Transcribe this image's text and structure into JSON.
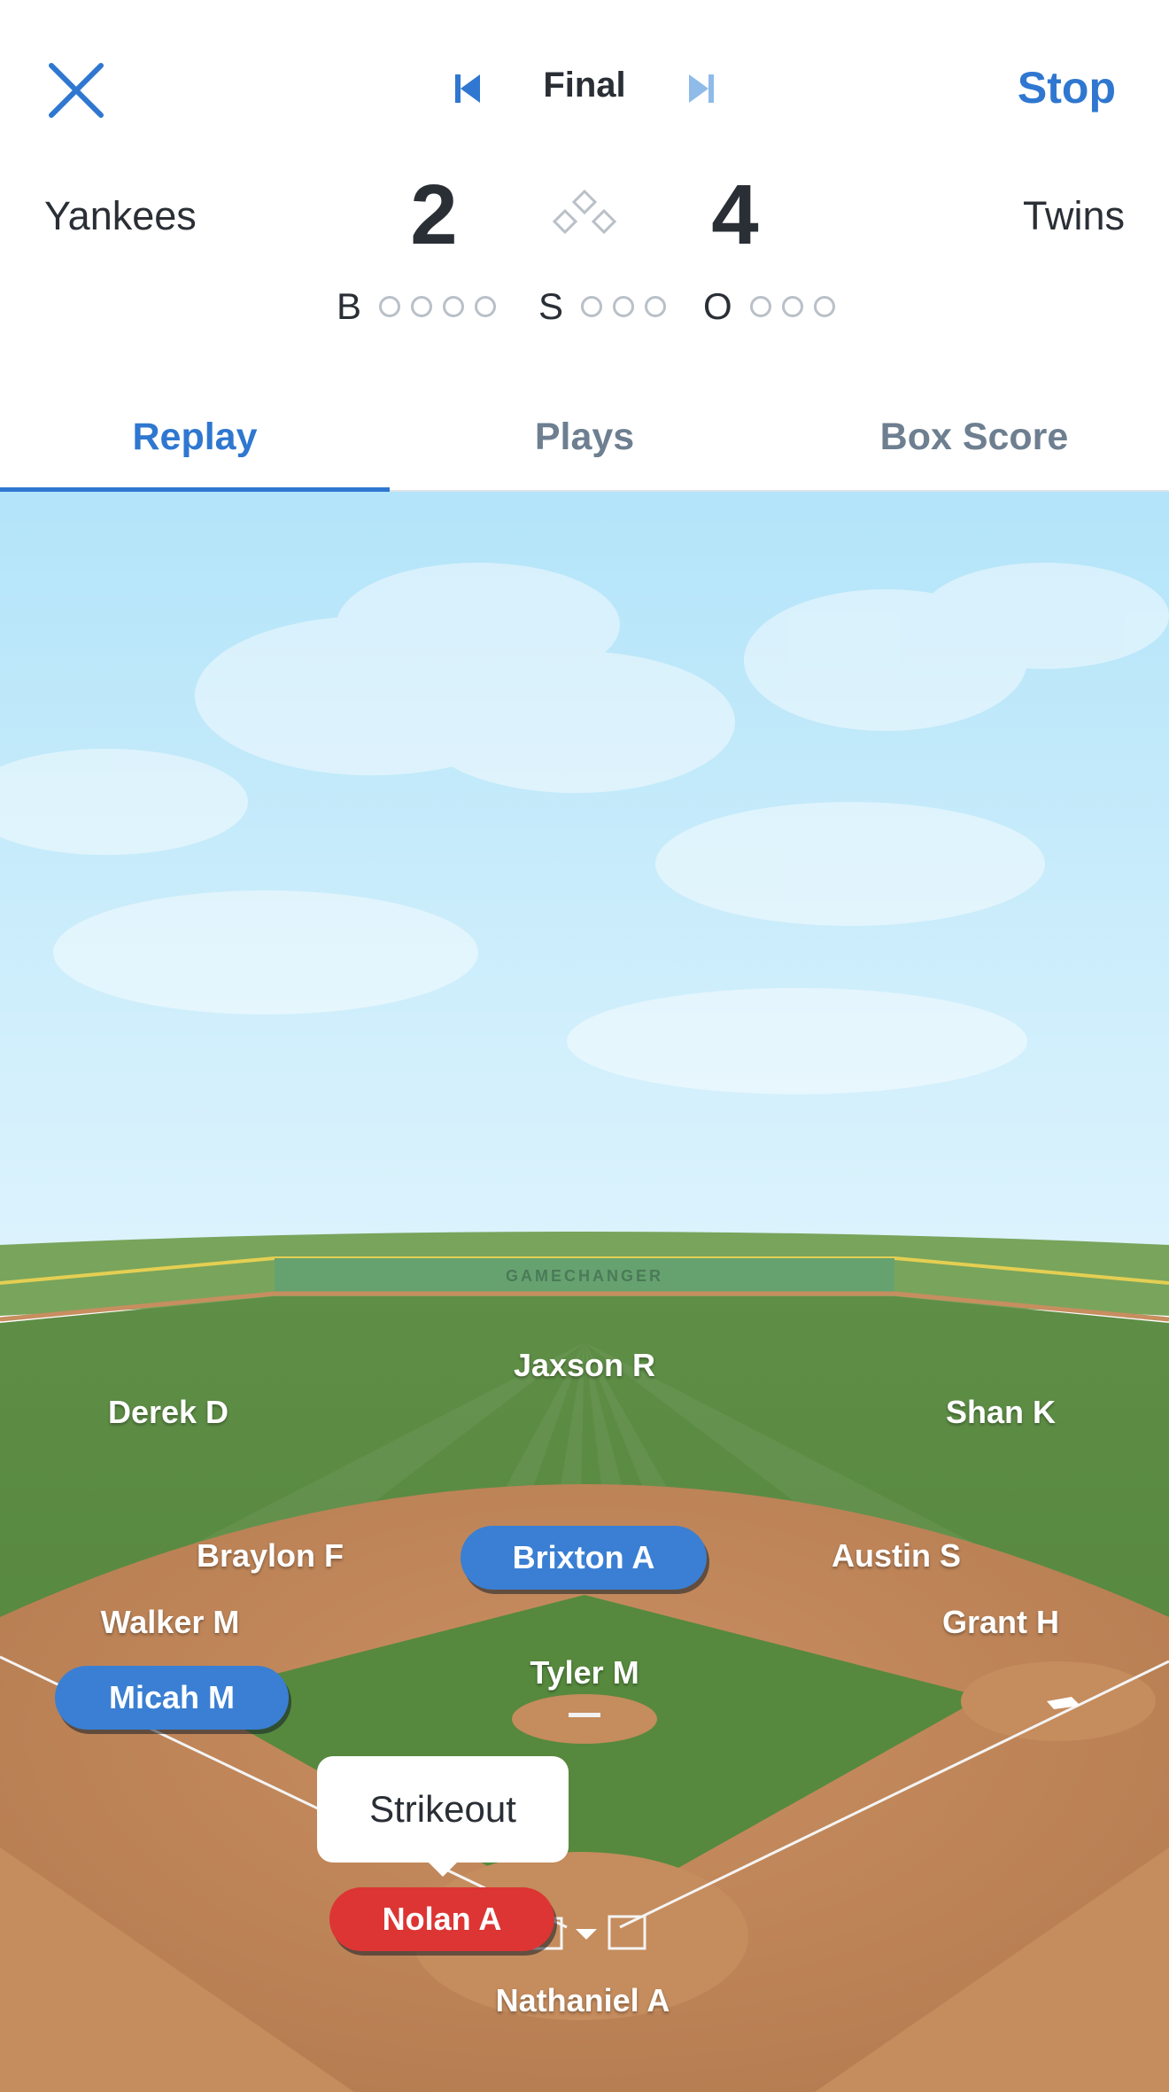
{
  "header": {
    "close_icon": "close-icon",
    "status": "Final",
    "stop_label": "Stop",
    "accent_color": "#2f77d0"
  },
  "scoreboard": {
    "away_team": "Yankees",
    "home_team": "Twins",
    "away_score": "2",
    "home_score": "4",
    "bases_icon": "bases-diamond-icon",
    "count": {
      "balls_label": "B",
      "strikes_label": "S",
      "outs_label": "O",
      "balls": 0,
      "strikes": 0,
      "outs": 0,
      "balls_max": 4,
      "strikes_max": 3,
      "outs_max": 3
    }
  },
  "tabs": [
    {
      "label": "Replay",
      "active": true
    },
    {
      "label": "Plays",
      "active": false
    },
    {
      "label": "Box Score",
      "active": false
    }
  ],
  "field": {
    "wall_sign": "GAMECHANGER",
    "fielders": {
      "left_field": "Derek D",
      "center_field": "Jaxson R",
      "right_field": "Shan K",
      "shortstop": "Braylon F",
      "second_base": "Austin S",
      "third_base": "Walker M",
      "first_base": "Grant H",
      "pitcher": "Tyler M",
      "catcher": "Nathaniel A"
    },
    "runners": {
      "second_base": "Brixton A",
      "third_base": "Micah M"
    },
    "batter": "Nolan A",
    "play_result": "Strikeout",
    "runner_color": "#3a7fd3",
    "batter_color": "#dc3533"
  }
}
